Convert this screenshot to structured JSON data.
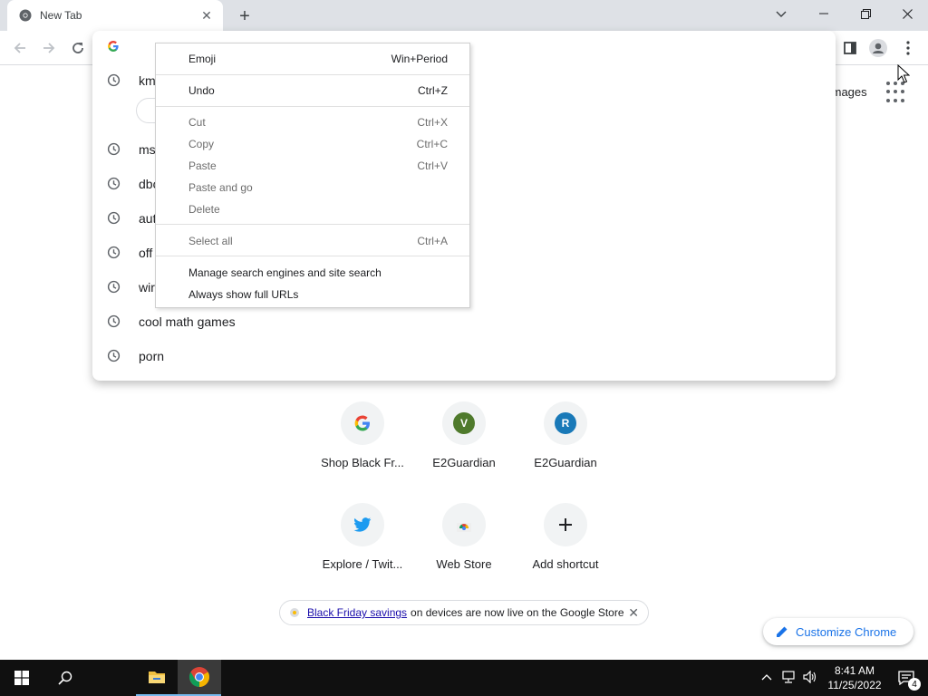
{
  "browser": {
    "tab_title": "New Tab"
  },
  "ntp": {
    "images_link": "Images",
    "shortcuts": [
      {
        "label": "Shop Black Fr...",
        "icon": "google-g-icon"
      },
      {
        "label": "E2Guardian",
        "letter": "V",
        "color": "#4f7a2c"
      },
      {
        "label": "E2Guardian",
        "letter": "R",
        "color": "#1979b8"
      },
      {
        "label": "Explore / Twit...",
        "icon": "twitter-icon"
      },
      {
        "label": "Web Store",
        "icon": "webstore-icon"
      },
      {
        "label": "Add shortcut",
        "icon": "plus-icon"
      }
    ],
    "promo": {
      "link_text": "Black Friday savings",
      "text": "on devices are now live on the Google Store"
    },
    "customize_label": "Customize Chrome"
  },
  "omnibox": {
    "suggestions": [
      {
        "text": "km"
      },
      {
        "text": "ms"
      },
      {
        "text": "dbc"
      },
      {
        "text": "aut"
      },
      {
        "text": "off"
      },
      {
        "text": "wir"
      },
      {
        "text": "cool math games"
      },
      {
        "text": "porn"
      }
    ]
  },
  "context_menu": {
    "items": [
      {
        "label": "Emoji",
        "shortcut": "Win+Period",
        "enabled": true
      },
      {
        "label": "Undo",
        "shortcut": "Ctrl+Z",
        "enabled": true
      },
      {
        "label": "Cut",
        "shortcut": "Ctrl+X",
        "enabled": false
      },
      {
        "label": "Copy",
        "shortcut": "Ctrl+C",
        "enabled": false
      },
      {
        "label": "Paste",
        "shortcut": "Ctrl+V",
        "enabled": false
      },
      {
        "label": "Paste and go",
        "shortcut": "",
        "enabled": false
      },
      {
        "label": "Delete",
        "shortcut": "",
        "enabled": false
      },
      {
        "label": "Select all",
        "shortcut": "Ctrl+A",
        "enabled": false
      },
      {
        "label": "Manage search engines and site search",
        "shortcut": "",
        "enabled": true
      },
      {
        "label": "Always show full URLs",
        "shortcut": "",
        "enabled": true
      }
    ]
  },
  "taskbar": {
    "time": "8:41 AM",
    "date": "11/25/2022",
    "notification_count": "4"
  }
}
